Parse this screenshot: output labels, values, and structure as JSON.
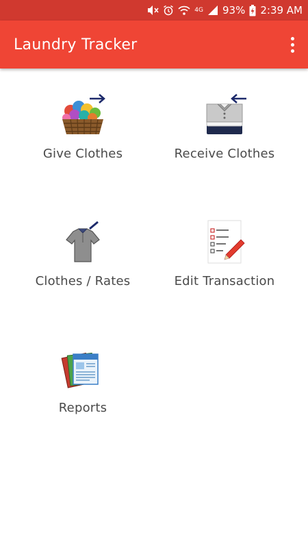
{
  "status_bar": {
    "network": "4G",
    "battery": "93%",
    "time": "2:39 AM"
  },
  "app_bar": {
    "title": "Laundry Tracker"
  },
  "menu": [
    {
      "id": "give",
      "label": "Give Clothes",
      "icon": "basket-give-icon"
    },
    {
      "id": "receive",
      "label": "Receive Clothes",
      "icon": "folded-shirt-receive-icon"
    },
    {
      "id": "rates",
      "label": "Clothes / Rates",
      "icon": "shirt-edit-icon"
    },
    {
      "id": "edit",
      "label": "Edit Transaction",
      "icon": "checklist-edit-icon"
    },
    {
      "id": "reports",
      "label": "Reports",
      "icon": "reports-icon"
    }
  ],
  "colors": {
    "status_bar": "#d0392f",
    "app_bar": "#ef4535",
    "label_text": "#4a4a4a"
  }
}
